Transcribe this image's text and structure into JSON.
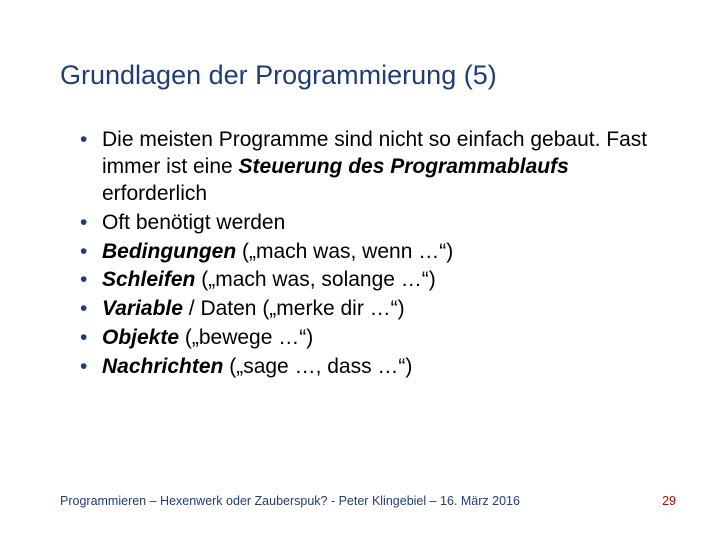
{
  "title": "Grundlagen der Programmierung (5)",
  "bullets": [
    {
      "pre": "Die meisten Programme sind nicht so einfach gebaut. Fast immer ist eine ",
      "bold": "Steuerung des Programmablaufs",
      "post": " erforderlich"
    },
    {
      "pre": "Oft benötigt werden",
      "bold": "",
      "post": ""
    },
    {
      "pre": "",
      "bold": "Bedingungen",
      "post": " („mach was, wenn …“)"
    },
    {
      "pre": "",
      "bold": "Schleifen",
      "post": " („mach was, solange …“)"
    },
    {
      "pre": "",
      "bold": "Variable",
      "post": " / Daten („merke dir …“)"
    },
    {
      "pre": "",
      "bold": "Objekte",
      "post": " („bewege …“)"
    },
    {
      "pre": "",
      "bold": "Nachrichten",
      "post": " („sage …, dass …“)"
    }
  ],
  "footer": {
    "left": "Programmieren – Hexenwerk oder Zauberspuk? - Peter Klingebiel – 16. März 2016",
    "right": "29"
  }
}
